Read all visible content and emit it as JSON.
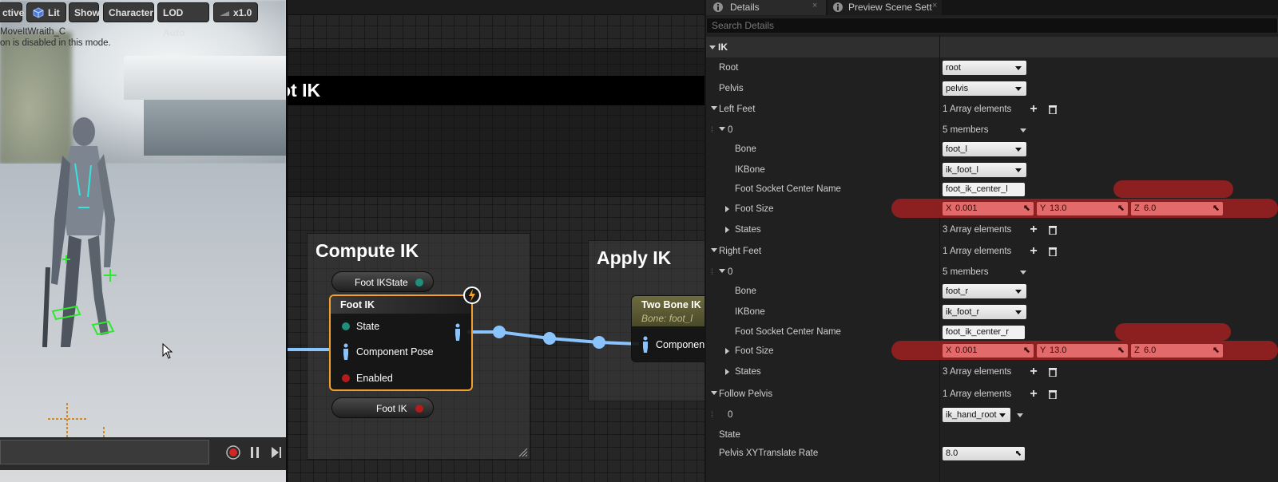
{
  "viewport": {
    "toolbar": {
      "perspective": "ctive",
      "lit": "Lit",
      "show": "Show",
      "character": "Character",
      "lod": "LOD Auto",
      "speed": "x1.0"
    },
    "overlay_line1": "MoveItWraith_C",
    "overlay_line2": "on is disabled in this mode."
  },
  "graph": {
    "header_title": "ot IK",
    "compute_comment": "Compute IK",
    "apply_comment": "Apply IK",
    "foot_ikstate_pill": "Foot IKState",
    "foot_ik_pill": "Foot IK",
    "foot_ik_node": {
      "title": "Foot IK",
      "pins": [
        "State",
        "Component Pose",
        "Enabled"
      ]
    },
    "two_bone_node": {
      "title": "Two Bone IK",
      "subtitle": "Bone: foot_l",
      "pin": "Component"
    }
  },
  "details": {
    "tabs": {
      "details": "Details",
      "preview": "Preview Scene Sett"
    },
    "search_placeholder": "Search Details",
    "category": "IK",
    "root": {
      "label": "Root",
      "value": "root"
    },
    "pelvis": {
      "label": "Pelvis",
      "value": "pelvis"
    },
    "left_feet": {
      "label": "Left Feet",
      "count": "1 Array elements",
      "index": "0",
      "members": "5 members",
      "bone_label": "Bone",
      "bone": "foot_l",
      "ikbone_label": "IKBone",
      "ikbone": "ik_foot_l",
      "socket_label": "Foot Socket Center Name",
      "socket": "foot_ik_center_l",
      "size_label": "Foot Size",
      "x": "0.001",
      "y": "13.0",
      "z": "6.0",
      "states_label": "States",
      "states": "3 Array elements"
    },
    "right_feet": {
      "label": "Right Feet",
      "count": "1 Array elements",
      "index": "0",
      "members": "5 members",
      "bone_label": "Bone",
      "bone": "foot_r",
      "ikbone_label": "IKBone",
      "ikbone": "ik_foot_r",
      "socket_label": "Foot Socket Center Name",
      "socket": "foot_ik_center_r",
      "size_label": "Foot Size",
      "x": "0.001",
      "y": "13.0",
      "z": "6.0",
      "states_label": "States",
      "states": "3 Array elements"
    },
    "follow_pelvis": {
      "label": "Follow Pelvis",
      "count": "1 Array elements",
      "index": "0",
      "value": "ik_hand_root"
    },
    "state": {
      "label": "State"
    },
    "pelvis_rate": {
      "label": "Pelvis XYTranslate Rate",
      "value": "8.0"
    },
    "axis_labels": {
      "x": "X",
      "y": "Y",
      "z": "Z"
    }
  }
}
